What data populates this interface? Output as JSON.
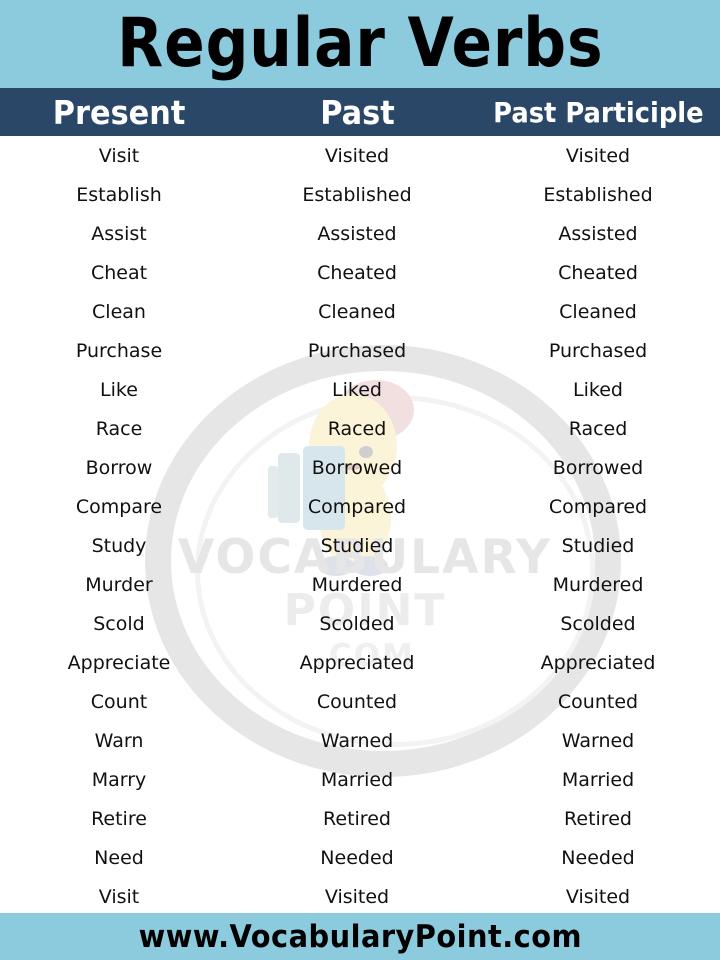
{
  "title": {
    "text": "Regular  Verbs",
    "background_color": "#8ccadd",
    "text_color": "#000000"
  },
  "table_header": {
    "background_color": "#2b4768",
    "text_color": "#ffffff",
    "columns": [
      {
        "label": "Present"
      },
      {
        "label": "Past"
      },
      {
        "label": "Past Participle"
      }
    ]
  },
  "watermark": {
    "line1": "VOCABULARY",
    "line2": "POINT",
    "line3": ".COM",
    "color": "#e6e6e6",
    "mascot": "mascot-character-with-book"
  },
  "footer": {
    "text": "www.VocabularyPoint.com",
    "background_color": "#8ccadd",
    "text_color": "#000000"
  },
  "rows": [
    {
      "present": "Visit",
      "past": "Visited",
      "past_participle": "Visited"
    },
    {
      "present": "Establish",
      "past": "Established",
      "past_participle": "Established"
    },
    {
      "present": "Assist",
      "past": "Assisted",
      "past_participle": "Assisted"
    },
    {
      "present": "Cheat",
      "past": "Cheated",
      "past_participle": "Cheated"
    },
    {
      "present": "Clean",
      "past": "Cleaned",
      "past_participle": "Cleaned"
    },
    {
      "present": "Purchase",
      "past": "Purchased",
      "past_participle": "Purchased"
    },
    {
      "present": "Like",
      "past": "Liked",
      "past_participle": "Liked"
    },
    {
      "present": "Race",
      "past": "Raced",
      "past_participle": "Raced"
    },
    {
      "present": "Borrow",
      "past": "Borrowed",
      "past_participle": "Borrowed"
    },
    {
      "present": "Compare",
      "past": "Compared",
      "past_participle": "Compared"
    },
    {
      "present": "Study",
      "past": "Studied",
      "past_participle": "Studied"
    },
    {
      "present": "Murder",
      "past": "Murdered",
      "past_participle": "Murdered"
    },
    {
      "present": "Scold",
      "past": "Scolded",
      "past_participle": "Scolded"
    },
    {
      "present": "Appreciate",
      "past": "Appreciated",
      "past_participle": "Appreciated"
    },
    {
      "present": "Count",
      "past": "Counted",
      "past_participle": "Counted"
    },
    {
      "present": "Warn",
      "past": "Warned",
      "past_participle": "Warned"
    },
    {
      "present": "Marry",
      "past": "Married",
      "past_participle": "Married"
    },
    {
      "present": "Retire",
      "past": "Retired",
      "past_participle": "Retired"
    },
    {
      "present": "Need",
      "past": "Needed",
      "past_participle": "Needed"
    },
    {
      "present": "Visit",
      "past": "Visited",
      "past_participle": "Visited"
    }
  ]
}
